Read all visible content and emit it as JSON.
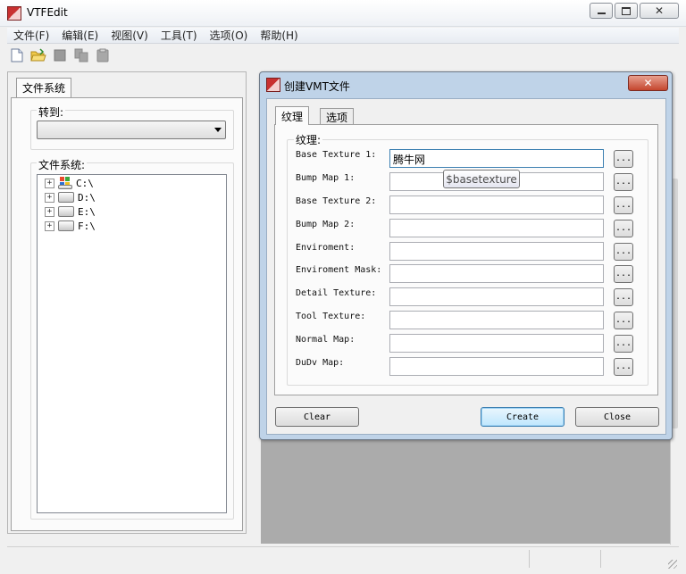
{
  "window": {
    "title": "VTFEdit"
  },
  "menu": [
    "文件(F)",
    "编辑(E)",
    "视图(V)",
    "工具(T)",
    "选项(O)",
    "帮助(H)"
  ],
  "toolbar": [
    "new-file-icon",
    "open-folder-icon",
    "save-icon",
    "copy-icon",
    "paste-icon"
  ],
  "left_pane": {
    "tab": "文件系统",
    "goto_label": "转到:",
    "goto_value": "",
    "tree_label": "文件系统:",
    "tree": [
      {
        "label": "C:\\",
        "icon": "system-drive-icon"
      },
      {
        "label": "D:\\",
        "icon": "drive-icon"
      },
      {
        "label": "E:\\",
        "icon": "drive-icon"
      },
      {
        "label": "F:\\",
        "icon": "drive-icon"
      }
    ]
  },
  "dialog": {
    "title": "创建VMT文件",
    "close_glyph": "✕",
    "tabs": [
      {
        "label": "纹理",
        "active": true
      },
      {
        "label": "选项",
        "active": false
      }
    ],
    "group_label": "纹理:",
    "fields": [
      {
        "label": "Base Texture 1:",
        "value": "腾牛网"
      },
      {
        "label": "Bump Map 1:",
        "value": ""
      },
      {
        "label": "Base Texture 2:",
        "value": ""
      },
      {
        "label": "Bump Map 2:",
        "value": ""
      },
      {
        "label": "Enviroment:",
        "value": ""
      },
      {
        "label": "Enviroment Mask:",
        "value": ""
      },
      {
        "label": "Detail Texture:",
        "value": ""
      },
      {
        "label": "Tool Texture:",
        "value": ""
      },
      {
        "label": "Normal Map:",
        "value": ""
      },
      {
        "label": "DuDv Map:",
        "value": ""
      }
    ],
    "browse_label": "...",
    "tooltip": "$basetexture",
    "buttons": {
      "clear": "Clear",
      "create": "Create",
      "close": "Close"
    }
  }
}
